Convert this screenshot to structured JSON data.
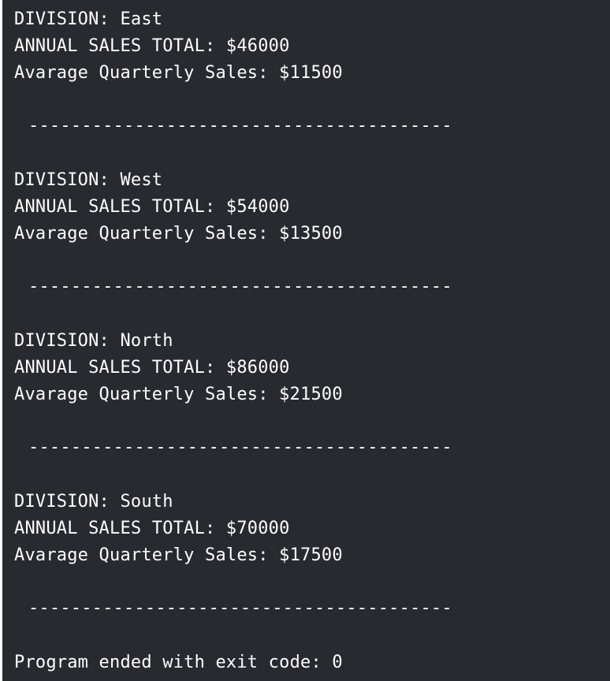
{
  "console": {
    "lines": [
      "DIVISION: East",
      "ANNUAL SALES TOTAL: $46000",
      "Avarage Quarterly Sales: $11500",
      "",
      "----------------------------------------",
      "",
      "DIVISION: West",
      "ANNUAL SALES TOTAL: $54000",
      "Avarage Quarterly Sales: $13500",
      "",
      "----------------------------------------",
      "",
      "DIVISION: North",
      "ANNUAL SALES TOTAL: $86000",
      "Avarage Quarterly Sales: $21500",
      "",
      "----------------------------------------",
      "",
      "DIVISION: South",
      "ANNUAL SALES TOTAL: $70000",
      "Avarage Quarterly Sales: $17500",
      "",
      "----------------------------------------",
      "",
      "Program ended with exit code: 0"
    ]
  }
}
